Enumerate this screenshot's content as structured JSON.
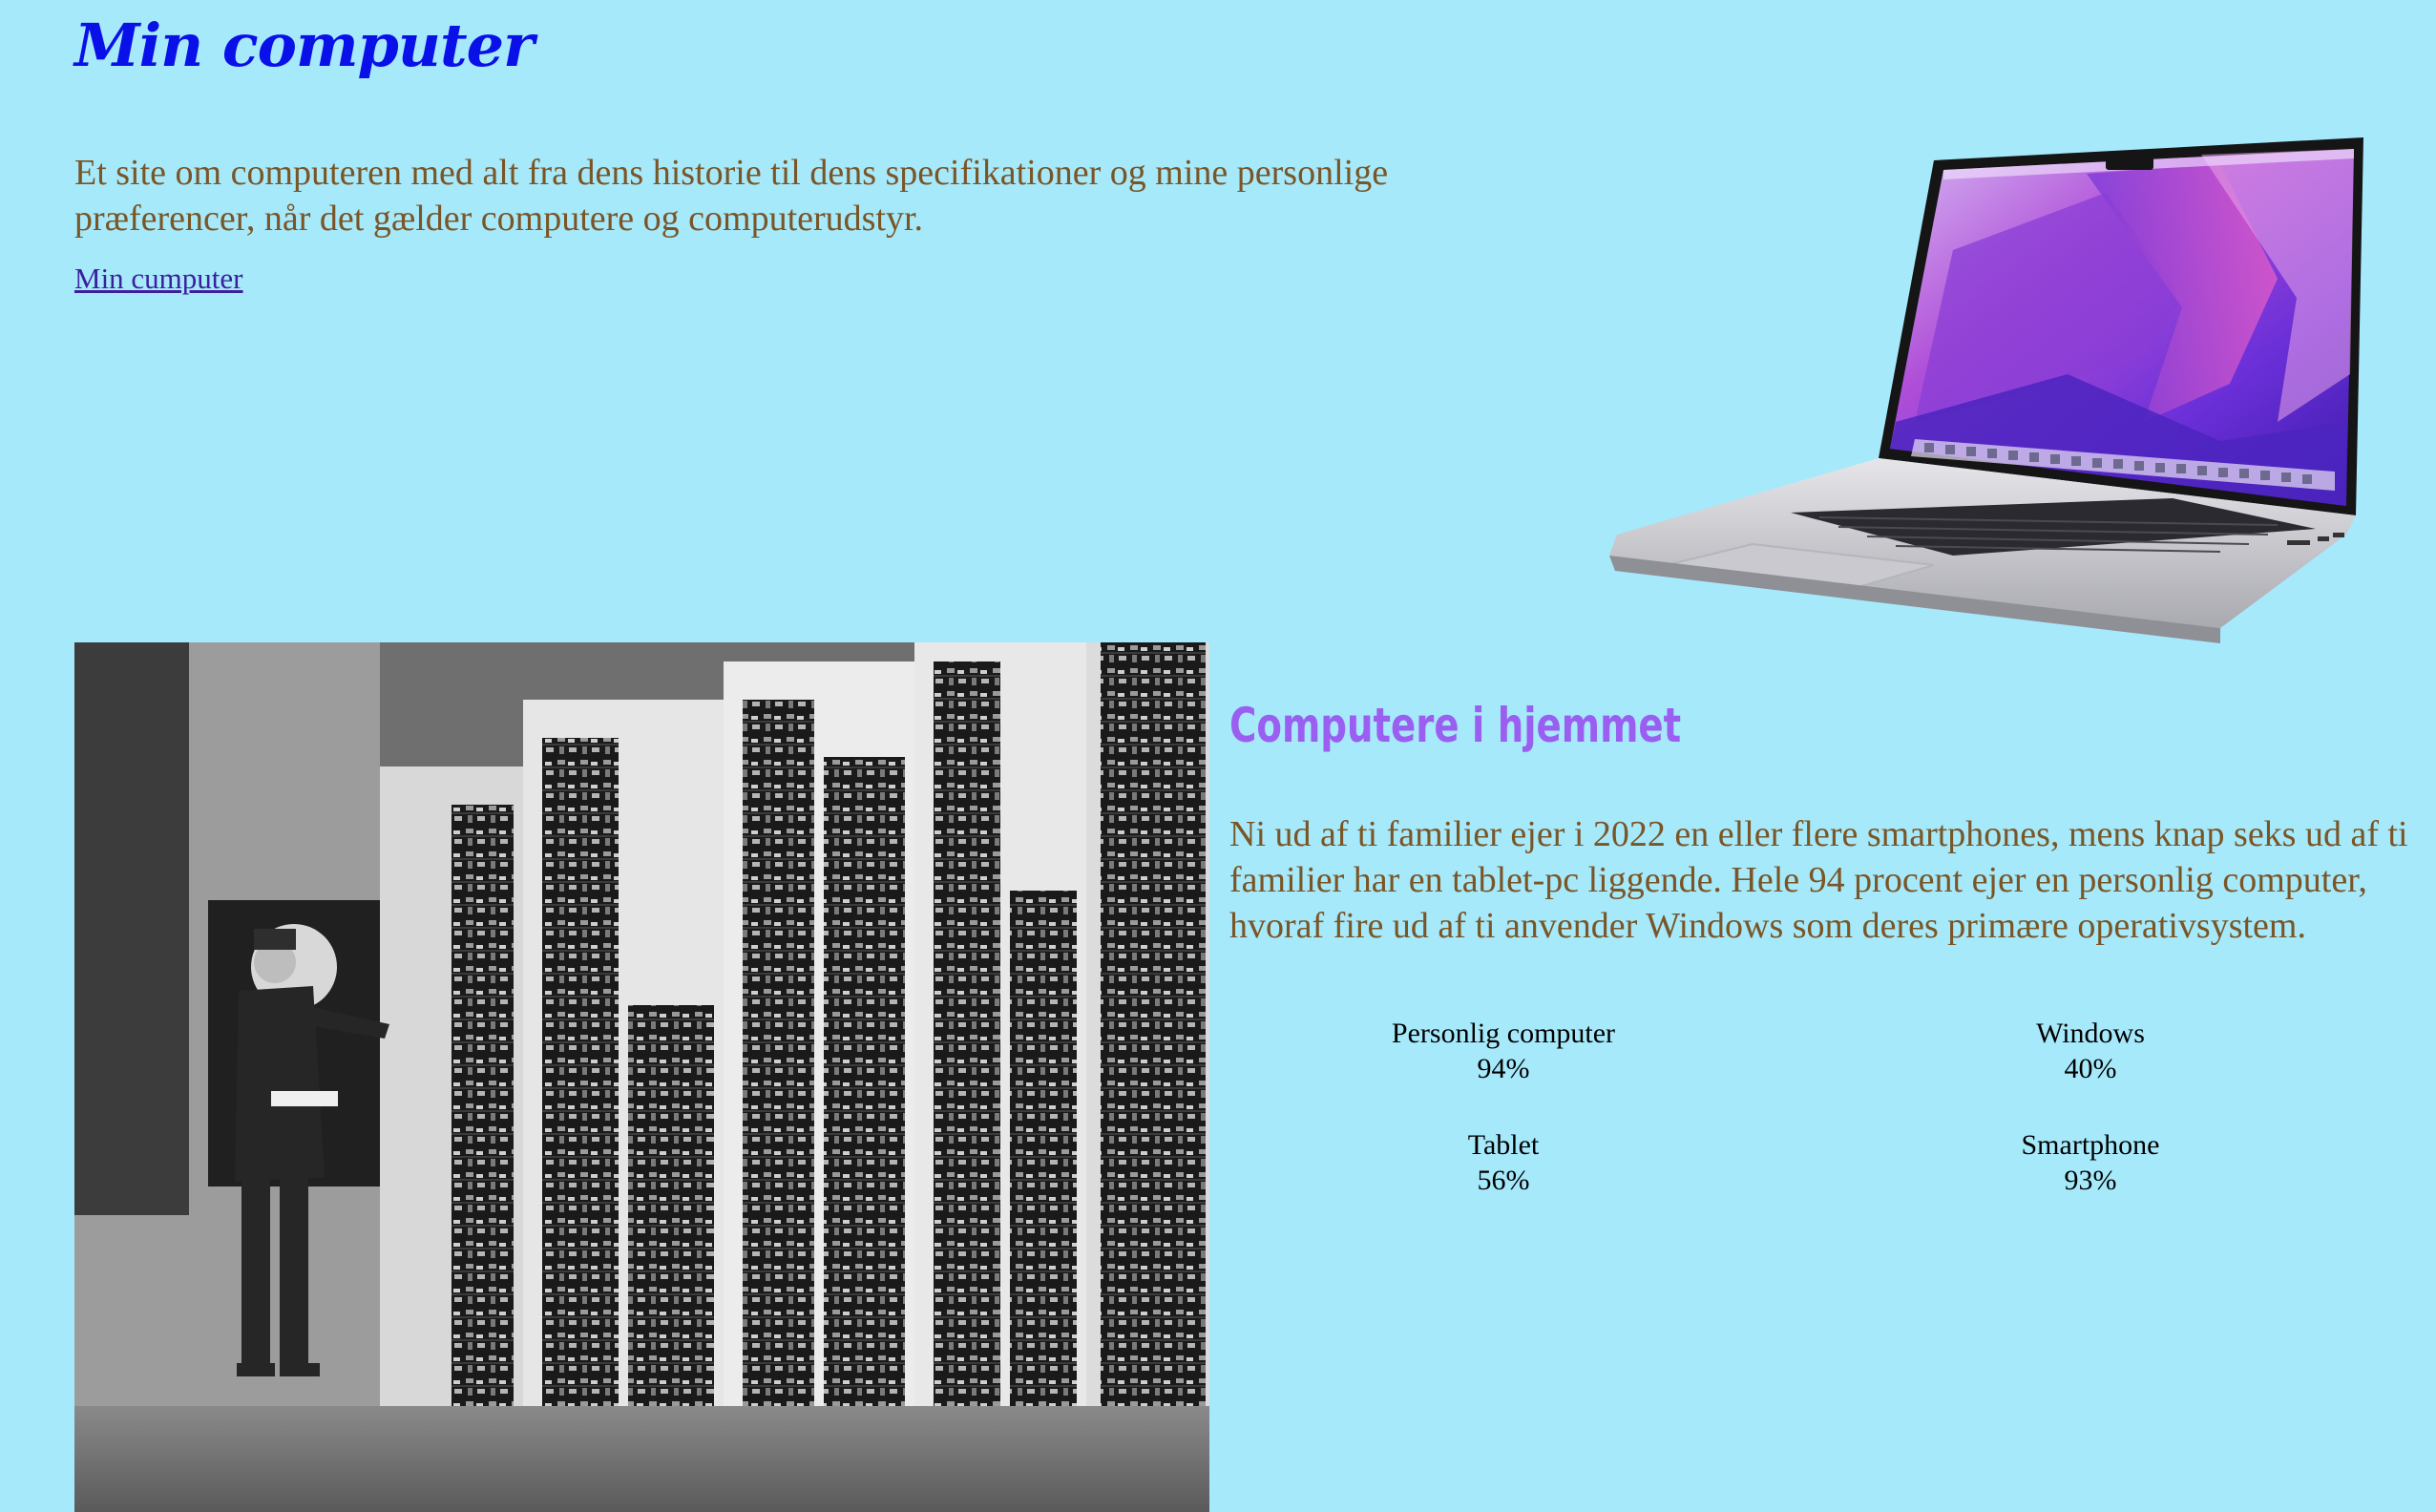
{
  "header": {
    "title": "Min computer",
    "intro": "Et site om computeren med alt fra dens historie til dens specifikationer og mine personlige præferencer, når det gælder computere og computerudstyr.",
    "link_label": "Min cumputer"
  },
  "images": {
    "laptop": "laptop-image",
    "historic_computer": "historic-computer-photo"
  },
  "section": {
    "title": "Computere i hjemmet",
    "text": "Ni ud af ti familier ejer i 2022 en eller flere smartphones, mens knap seks ud af ti familier har en tablet-pc liggende. Hele 94 procent ejer en personlig computer, hvoraf fire ud af ti anvender Windows som deres primære operativsystem."
  },
  "stats": [
    {
      "label": "Personlig computer",
      "value": "94%"
    },
    {
      "label": "Windows",
      "value": "40%"
    },
    {
      "label": "Tablet",
      "value": "56%"
    },
    {
      "label": "Smartphone",
      "value": "93%"
    }
  ],
  "colors": {
    "background": "#a6e9fb",
    "title": "#0a10e8",
    "body_text": "#7a5526",
    "link": "#3b1f9e",
    "section_title": "#9a5ff0"
  }
}
